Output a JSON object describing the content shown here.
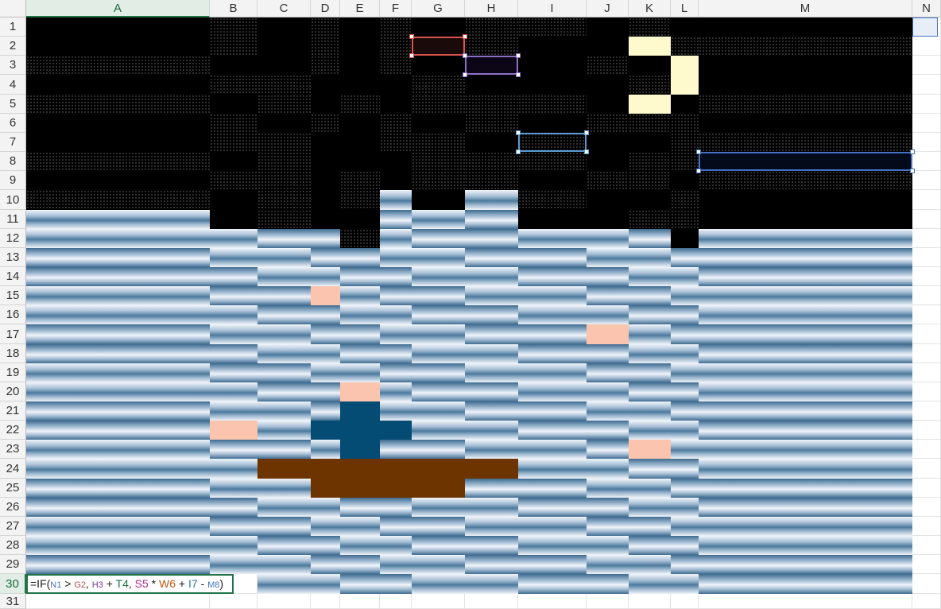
{
  "columns": [
    "A",
    "B",
    "C",
    "D",
    "E",
    "F",
    "G",
    "H",
    "I",
    "J",
    "K",
    "L",
    "M",
    "N"
  ],
  "rows": [
    "1",
    "2",
    "3",
    "4",
    "5",
    "6",
    "7",
    "8",
    "9",
    "10",
    "11",
    "12",
    "13",
    "14",
    "15",
    "16",
    "17",
    "18",
    "19",
    "20",
    "21",
    "22",
    "23",
    "24",
    "25",
    "26",
    "27",
    "28",
    "29",
    "30",
    "31"
  ],
  "active_cell": "A30",
  "formula": {
    "prefix": "=IF(",
    "tokens": [
      {
        "text": "N1",
        "color": "#4472c4",
        "small": true
      },
      {
        "text": " > ",
        "color": "#222222",
        "small": false
      },
      {
        "text": "G2",
        "color": "#c0504d",
        "small": true
      },
      {
        "text": ", ",
        "color": "#222222",
        "small": false
      },
      {
        "text": "H3",
        "color": "#7030a0",
        "small": true
      },
      {
        "text": " + ",
        "color": "#222222",
        "small": false
      },
      {
        "text": "T4",
        "color": "#1e7145",
        "small": false
      },
      {
        "text": ", ",
        "color": "#222222",
        "small": false
      },
      {
        "text": "S5",
        "color": "#b4298a",
        "small": false
      },
      {
        "text": " * ",
        "color": "#222222",
        "small": false
      },
      {
        "text": "W6",
        "color": "#c55a11",
        "small": false
      },
      {
        "text": " + ",
        "color": "#222222",
        "small": false
      },
      {
        "text": "I7",
        "color": "#2e75b6",
        "small": false
      },
      {
        "text": " - ",
        "color": "#222222",
        "small": false
      },
      {
        "text": "M8",
        "color": "#4472c4",
        "small": true
      },
      {
        "text": ")",
        "color": "#222222",
        "small": false
      }
    ]
  },
  "colors": {
    "night": "#000000",
    "moon": "#fffacd",
    "sea_light": "#f1f5fa",
    "sea_dark": "#3e6b8f",
    "peach": "#fbc4ae",
    "navy": "#054c74",
    "hull": "#6d3400",
    "accent": "#217346"
  }
}
